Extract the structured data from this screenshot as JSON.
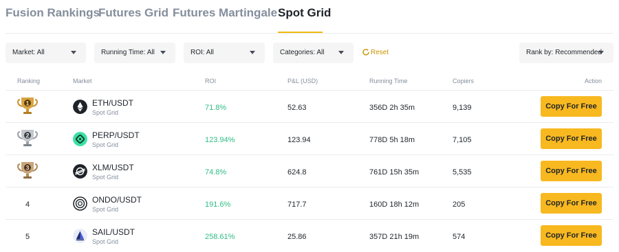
{
  "tabs": [
    {
      "label": "Fusion Rankings",
      "active": false
    },
    {
      "label": "Futures Grid",
      "active": false
    },
    {
      "label": "Futures Martingale",
      "active": false
    },
    {
      "label": "Spot Grid",
      "active": true
    }
  ],
  "filters": {
    "market": "Market: All",
    "running_time": "Running Time: All",
    "roi": "ROI: All",
    "categories": "Categories: All",
    "reset": "Reset",
    "rank_by": "Rank by: Recommended"
  },
  "columns": {
    "ranking": "Ranking",
    "market": "Market",
    "roi": "ROI",
    "pnl": "P&L (USD)",
    "running_time": "Running Time",
    "copiers": "Copiers",
    "action": "Action"
  },
  "colors": {
    "accent": "#f0b90b",
    "button": "#f8b81f",
    "positive": "#2ebd85",
    "gold": "#c9922e",
    "silver": "#9aa0a6",
    "bronze": "#b08a5a"
  },
  "rows": [
    {
      "rank": "1",
      "trophy": "gold-trophy-icon",
      "pair": "ETH/USDT",
      "type": "Spot Grid",
      "coin_icon": "eth-icon",
      "roi": "71.8%",
      "pnl": "52.63",
      "running_time": "356D 2h 35m",
      "copiers": "9,139",
      "action": "Copy For Free"
    },
    {
      "rank": "2",
      "trophy": "silver-trophy-icon",
      "pair": "PERP/USDT",
      "type": "Spot Grid",
      "coin_icon": "perp-icon",
      "roi": "123.94%",
      "pnl": "123.94",
      "running_time": "778D 5h 18m",
      "copiers": "7,105",
      "action": "Copy For Free"
    },
    {
      "rank": "3",
      "trophy": "bronze-trophy-icon",
      "pair": "XLM/USDT",
      "type": "Spot Grid",
      "coin_icon": "xlm-icon",
      "roi": "74.8%",
      "pnl": "624.8",
      "running_time": "761D 15h 35m",
      "copiers": "5,535",
      "action": "Copy For Free"
    },
    {
      "rank": "4",
      "pair": "ONDO/USDT",
      "type": "Spot Grid",
      "coin_icon": "ondo-icon",
      "roi": "191.6%",
      "pnl": "717.7",
      "running_time": "160D 18h 12m",
      "copiers": "205",
      "action": "Copy For Free"
    },
    {
      "rank": "5",
      "pair": "SAIL/USDT",
      "type": "Spot Grid",
      "coin_icon": "sail-icon",
      "roi": "258.61%",
      "pnl": "25.86",
      "running_time": "357D 21h 19m",
      "copiers": "574",
      "action": "Copy For Free"
    }
  ]
}
